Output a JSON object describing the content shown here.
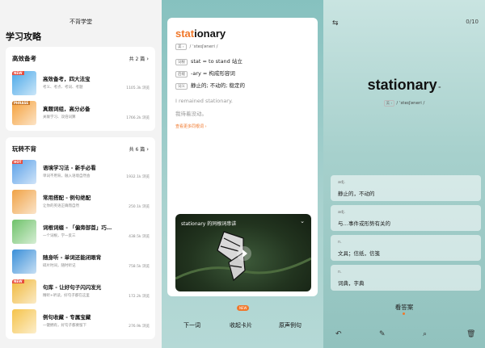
{
  "panel1": {
    "header_title": "不背学堂",
    "page_title": "学习攻略",
    "sections": [
      {
        "title": "高效备考",
        "count": "共 2 篇",
        "items": [
          {
            "title": "高效备考，四大法宝",
            "subtitle": "考义、考点、考词、考题",
            "views": "1105.3k 浏览",
            "badge": "NEW",
            "color": "#4aa8e8"
          },
          {
            "title": "真题词组，高分必备",
            "subtitle": "关联学习、双倍词算",
            "views": "1766.2k 浏览",
            "badge": "PHRASE",
            "color": "#f5a03a"
          }
        ]
      },
      {
        "title": "玩转不背",
        "count": "共 6 篇",
        "items": [
          {
            "title": "语境学习法 - 新手必看",
            "subtitle": "单词不用背，融入语境自然会",
            "views": "1932.1k 浏览",
            "badge": "HOT",
            "color": "#5aa0e8"
          },
          {
            "title": "常用搭配 - 例句绝配",
            "subtitle": "让你的英语正确而自然",
            "views": "250.1k 浏览",
            "badge": "",
            "color": "#f0a245"
          },
          {
            "title": "词根词缀 - 「偏旁部首」巧…",
            "subtitle": "一个词根，学一反三",
            "views": "438.5k 浏览",
            "badge": "",
            "color": "#6fc26a"
          },
          {
            "title": "随身听 - 单词还能闭眼背",
            "subtitle": "碎片时间，随时听记",
            "views": "758.5k 浏览",
            "badge": "",
            "color": "#3a8fd8"
          },
          {
            "title": "句库 - 让好句子闪闪发光",
            "subtitle": "精听+听读，好句子都在这里",
            "views": "172.2k 浏览",
            "badge": "NEW",
            "color": "#f0b83a"
          },
          {
            "title": "例句收藏 - 专属宝藏",
            "subtitle": "一键拥有，好句子都要留下",
            "views": "276.9k 浏览",
            "badge": "",
            "color": "#f5c34a"
          }
        ]
      }
    ]
  },
  "panel2": {
    "word_highlight": "stat",
    "word_rest": "ionary",
    "region": "美 ›",
    "phonetic": "/ ˈsteɪʃəneri /",
    "breakdown": [
      {
        "tag": "词根",
        "text": "stat = to stand 站立"
      },
      {
        "tag": "后缀",
        "text": "-ary = 构成形容词"
      },
      {
        "tag": "词义",
        "text": "静止的; 不动的; 稳定的"
      }
    ],
    "example_en": "I remained stationary.",
    "example_cn": "我待着没动。",
    "more_link": "查看更多同根词 ›",
    "video_title": "stationary 的同根词串讲",
    "video_chevron": "⌄",
    "badge": "NEW",
    "buttons": [
      "下一词",
      "收起卡片",
      "原声例句"
    ]
  },
  "panel3": {
    "settings_icon": "⇆",
    "progress": "0/10",
    "word": "stationary",
    "region": "美 ›",
    "phonetic": "/ ˈsteɪʃəneri /",
    "options": [
      {
        "pos": "adj.",
        "def": "静止的，不动的"
      },
      {
        "pos": "adj.",
        "def": "与…事件或形势有关的"
      },
      {
        "pos": "n.",
        "def": "文具；信纸，信笺"
      },
      {
        "pos": "n.",
        "def": "词典，字典"
      }
    ],
    "see_answer": "看答案",
    "toolbar": [
      "↶",
      "✎",
      "⌕",
      "🗑"
    ]
  }
}
